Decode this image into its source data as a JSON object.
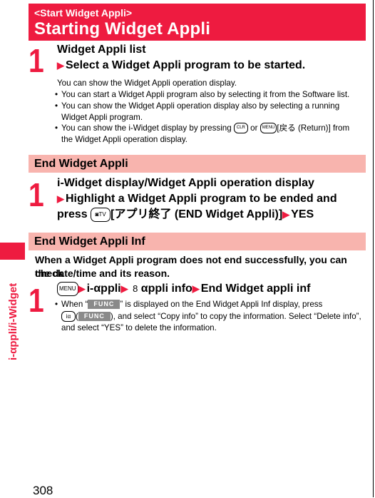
{
  "header": {
    "subtitle": "<Start Widget Appli>",
    "title": "Starting Widget Appli"
  },
  "section1": {
    "step_number": "1",
    "step_line1": "Widget Appli list",
    "step_line2": "Select a Widget Appli program to be started.",
    "description": "You can show the Widget Appli operation display.",
    "bullets": [
      "You can start a Widget Appli program also by selecting it from the Software list.",
      "You can show the Widget Appli operation display also by selecting a running",
      "Widget Appli program.",
      "You can show the i-Widget display by pressing",
      "or",
      "[戻る (Return)] from",
      "the Widget Appli operation display."
    ],
    "keys": {
      "clr": "CLR",
      "menu": "MENU"
    }
  },
  "section2": {
    "heading": "End Widget Appli",
    "step_number": "1",
    "step_line1": "i-Widget display/Widget Appli operation display",
    "step_line2": "Highlight a Widget Appli program to be ended and",
    "step_line3_a": "press",
    "step_line3_b": "[アプリ終了 (END Widget Appli)]",
    "step_line3_c": "YES",
    "keys": {
      "camera_tv": "TV"
    }
  },
  "section3": {
    "heading": "End Widget Appli Inf",
    "lead_line1": "When a Widget Appli program does not end successfully, you can check",
    "lead_line2": "the date/time and its reason.",
    "step_number": "1",
    "nav": [
      "i-αppli",
      "αppli info",
      "End Widget appli inf"
    ],
    "keys": {
      "menu": "MENU",
      "ia": "iα",
      "func": "FUNC"
    },
    "bullet_a": "When “",
    "bullet_b": "” is displayed on the End Widget Appli Inf display, press",
    "bullet_c": "(",
    "bullet_d": "), and select “Copy info” to copy the information. Select “Delete info”,",
    "bullet_e": "and select “YES” to delete the information."
  },
  "side_tab": {
    "label": "i-αppli/i-Widget"
  },
  "page_number": "308",
  "colors": {
    "accent": "#ee1b40",
    "section_bar": "#f8b4ae",
    "func_badge": "#8a8a8a"
  }
}
